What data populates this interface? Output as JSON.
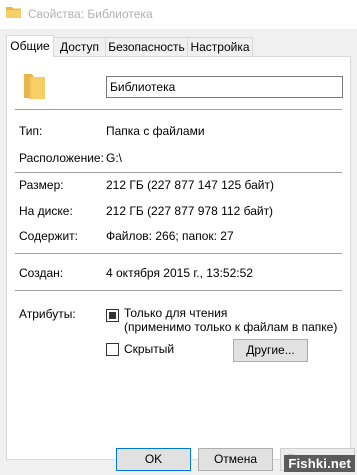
{
  "window": {
    "title": "Свойства: Библиотека"
  },
  "tabs": [
    {
      "label": "Общие",
      "active": true
    },
    {
      "label": "Доступ"
    },
    {
      "label": "Безопасность"
    },
    {
      "label": "Настройка"
    }
  ],
  "general": {
    "name_value": "Библиотека",
    "type": {
      "label": "Тип:",
      "value": "Папка с файлами"
    },
    "location": {
      "label": "Расположение:",
      "value": "G:\\"
    },
    "size": {
      "label": "Размер:",
      "value": "212 ГБ (227 877 147 125 байт)"
    },
    "on_disk": {
      "label": "На диске:",
      "value": "212 ГБ (227 877 978 112 байт)"
    },
    "contains": {
      "label": "Содержит:",
      "value": "Файлов: 266; папок: 27"
    },
    "created": {
      "label": "Создан:",
      "value": "4 октября 2015 г., 13:52:52"
    },
    "attributes": {
      "label": "Атрибуты:",
      "readonly": {
        "label_line1": "Только для чтения",
        "label_line2": "(применимо только к файлам в папке)",
        "state": "indeterminate"
      },
      "hidden": {
        "label": "Скрытый",
        "checked": false
      },
      "other_button": "Другие..."
    }
  },
  "footer": {
    "ok": "OK",
    "cancel": "Отмена",
    "apply": "Применить"
  },
  "watermark": "Fishki.net",
  "icons": {
    "title": "folder-icon",
    "main": "folder-icon"
  },
  "colors": {
    "folder": "#f2c45a",
    "focus_border": "#0078d7"
  }
}
